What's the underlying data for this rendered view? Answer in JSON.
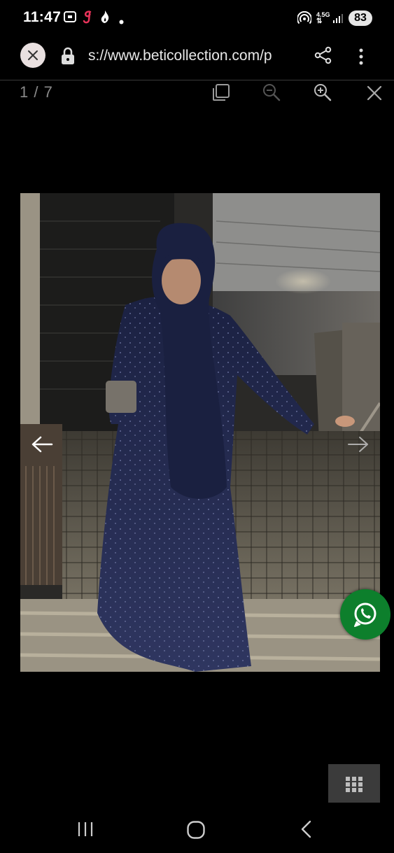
{
  "status_bar": {
    "time": "11:47",
    "network": "4.5G",
    "battery": "83",
    "icons": [
      "screenshot-icon",
      "g-app-icon",
      "flame-app-icon",
      "dot-icon",
      "hotspot-icon",
      "signal-icon"
    ]
  },
  "browser": {
    "url": "s://www.beticollection.com/p",
    "icons": [
      "close-icon",
      "lock-icon",
      "share-icon",
      "more-vert-icon"
    ]
  },
  "lightbox": {
    "counter": "1 / 7",
    "icons": [
      "fullscreen-icon",
      "zoom-out-icon",
      "zoom-in-icon",
      "close-icon",
      "arrow-left-icon",
      "arrow-right-icon"
    ]
  },
  "photo": {
    "subject": "woman in navy sequin abaya with hijab walking down stairs"
  },
  "floating": {
    "whatsapp_icon": "whatsapp-icon",
    "grid_icon": "grid-icon",
    "whatsapp_color": "#0d7f2c"
  },
  "nav_bar": {
    "icons": [
      "recents-icon",
      "home-icon",
      "back-icon"
    ]
  },
  "colors": {
    "background": "#000000",
    "photo_dress": "#1f2748",
    "toolbar_icon": "#9a9a9a"
  }
}
